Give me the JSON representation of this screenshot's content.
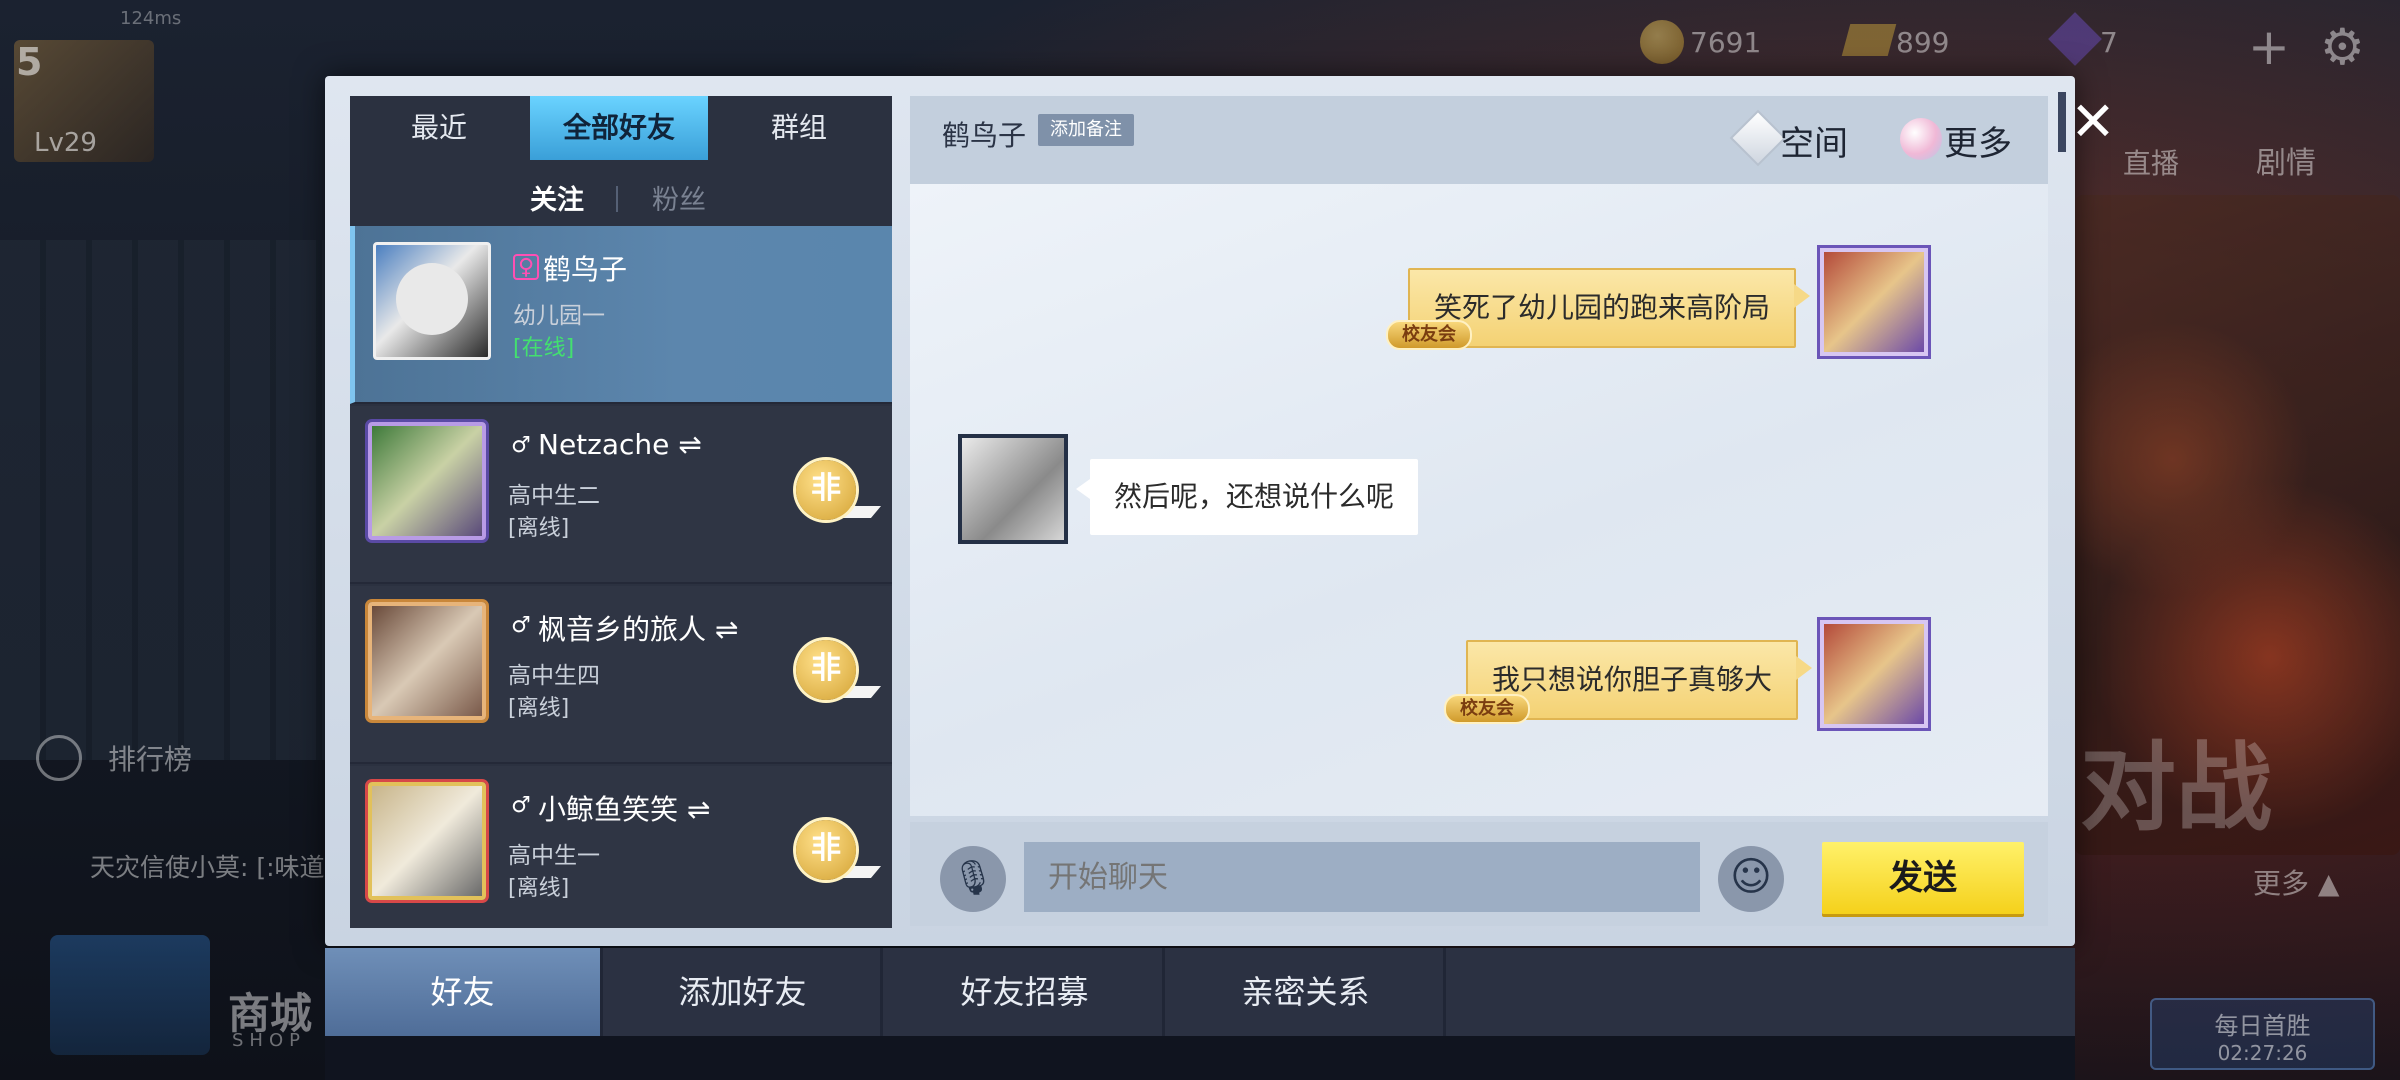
{
  "hud": {
    "ping": "124ms",
    "player_level": "5",
    "player_lv_text": "Lv29",
    "coins": "7691",
    "gold": "899",
    "gems": "7"
  },
  "background": {
    "ranking": "排行榜",
    "announcement": "天灾信使小莫: [:味道",
    "live": "直播",
    "drama": "剧情",
    "battle_text": "对战",
    "more": "更多 ▲",
    "daily_first_recharge": "每日首胜",
    "timer": "02:27:26",
    "shop_cn": "商城",
    "shop_en": "SHOP"
  },
  "friends_panel": {
    "tabs": [
      "最近",
      "全部好友",
      "群组"
    ],
    "active_tab_index": 1,
    "subtabs": [
      "关注",
      "粉丝"
    ],
    "active_subtab_index": 0,
    "friends": [
      {
        "gender": "♀",
        "name": "鹤鸟子",
        "grade": "幼儿园一",
        "status": "[在线]",
        "online": true,
        "badge": null
      },
      {
        "gender": "♂",
        "name": "Netzache ⇌",
        "grade": "高中生二",
        "status": "[离线]",
        "online": false,
        "badge": "非"
      },
      {
        "gender": "♂",
        "name": "枫音乡的旅人 ⇌",
        "grade": "高中生四",
        "status": "[离线]",
        "online": false,
        "badge": "非"
      },
      {
        "gender": "♂",
        "name": "小鲸鱼笑笑 ⇌",
        "grade": "高中生一",
        "status": "[离线]",
        "online": false,
        "badge": "非"
      }
    ]
  },
  "chat": {
    "partner_name": "鹤鸟子",
    "add_note_label": "添加备注",
    "space_label": "空间",
    "more_label": "更多",
    "messages": [
      {
        "side": "right",
        "text": "笑死了幼儿园的跑来高阶局",
        "tag": "校友会"
      },
      {
        "side": "left",
        "text": "然后呢，还想说什么呢"
      },
      {
        "side": "right",
        "text": "我只想说你胆子真够大",
        "tag": "校友会"
      }
    ],
    "input_placeholder": "开始聊天",
    "send_label": "发送"
  },
  "bottom_tabs": [
    "好友",
    "添加好友",
    "好友招募",
    "亲密关系"
  ],
  "active_bottom_tab_index": 0,
  "icons": {
    "close": "close-icon",
    "mic": "microphone-icon",
    "emoji": "emoji-icon",
    "space": "space-icon",
    "more": "more-icon"
  },
  "colors": {
    "active_tab": "#4fb6ea",
    "online_status": "#43e06f",
    "send_button": "#f5d11b",
    "bubble_self": "#f4d274"
  }
}
